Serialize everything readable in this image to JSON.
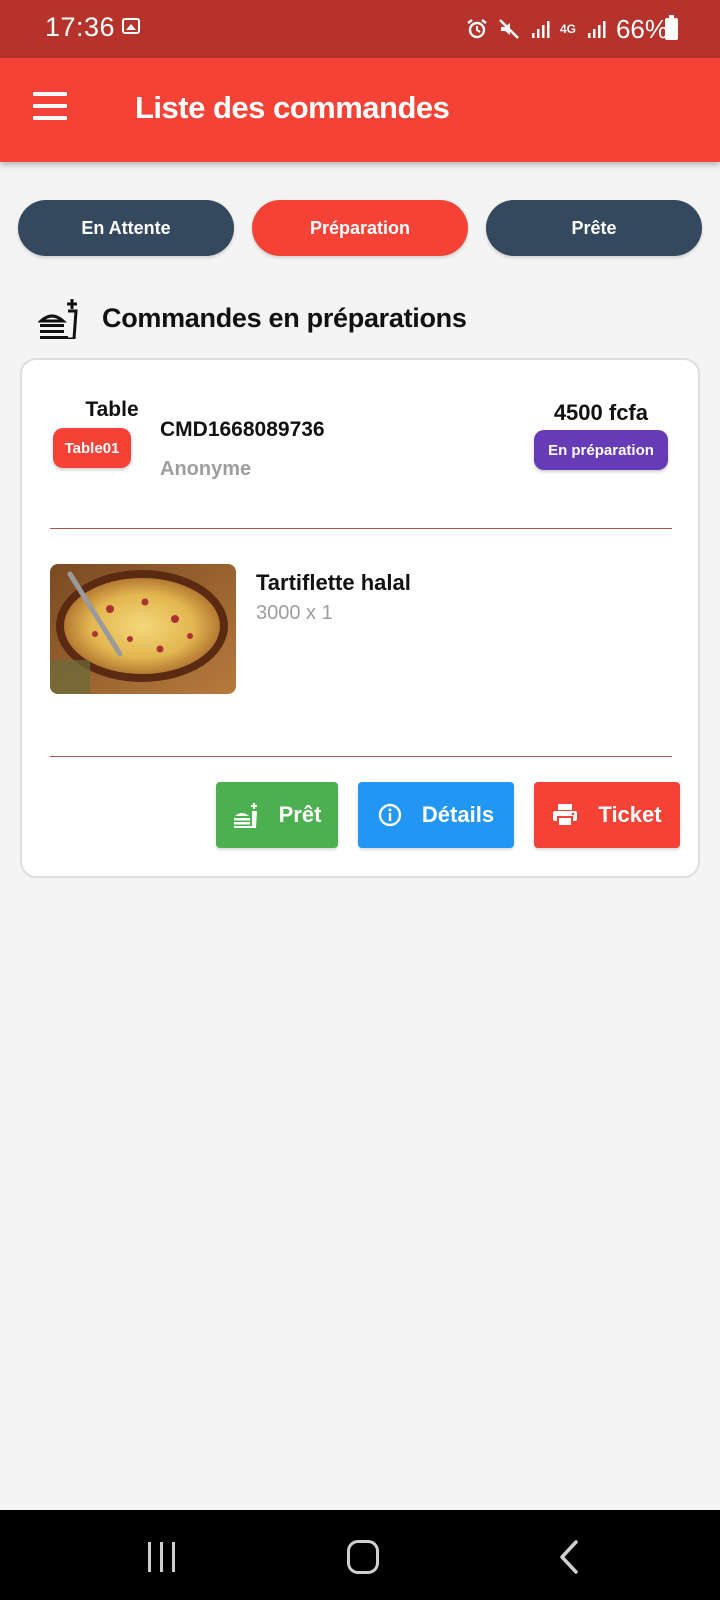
{
  "status_bar": {
    "time": "17:36",
    "network": "4G",
    "battery": "66%"
  },
  "app_bar": {
    "title": "Liste des commandes",
    "color": "#f44336"
  },
  "tabs": [
    {
      "label": "En Attente",
      "active": false
    },
    {
      "label": "Préparation",
      "active": true
    },
    {
      "label": "Prête",
      "active": false
    }
  ],
  "section": {
    "title": "Commandes en préparations",
    "icon": "food-service-icon"
  },
  "order": {
    "table_label": "Table",
    "table_name": "Table01",
    "order_id": "CMD1668089736",
    "customer": "Anonyme",
    "total": "4500 fcfa",
    "status": "En préparation",
    "items": [
      {
        "name": "Tartiflette halal",
        "quantity_text": "3000 x 1"
      }
    ],
    "actions": {
      "ready": "Prêt",
      "details": "Détails",
      "ticket": "Ticket"
    }
  },
  "colors": {
    "primary_red": "#f44336",
    "dark_tab": "#34495e",
    "status_purple": "#673ab7",
    "ready_green": "#4caf50",
    "details_blue": "#2196f3"
  }
}
